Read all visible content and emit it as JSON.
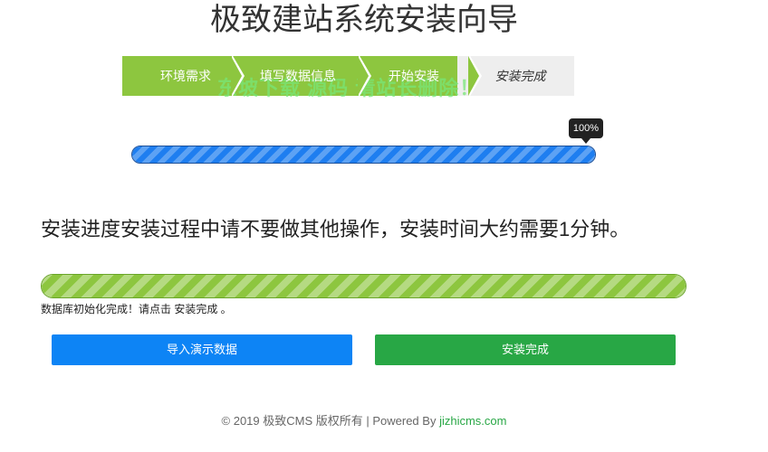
{
  "title": "极致建站系统安装向导",
  "steps": [
    {
      "label": "环境需求",
      "state": "done"
    },
    {
      "label": "填写数据信息",
      "state": "done"
    },
    {
      "label": "开始安装",
      "state": "done"
    },
    {
      "label": "安装完成",
      "state": "current"
    }
  ],
  "watermark": "东坡下载   源码  请站长删除！",
  "progress_top": {
    "tooltip": "100%",
    "fraction": 1.0
  },
  "install_message": "安装进度安装过程中请不要做其他操作，安装时间大约需要1分钟。",
  "progress_bottom": {
    "fraction": 1.0
  },
  "status_line": "数据库初始化完成！请点击 安装完成 。",
  "buttons": {
    "import_demo": "导入演示数据",
    "finish": "安装完成"
  },
  "footer": {
    "text": "© 2019 极致CMS 版权所有 | Powered By ",
    "link_text": "jizhicms.com"
  },
  "colors": {
    "step_green": "#8dc63f",
    "blue_bar": "#1e7ef0",
    "btn_blue": "#0d84f5",
    "btn_green": "#28a745"
  }
}
